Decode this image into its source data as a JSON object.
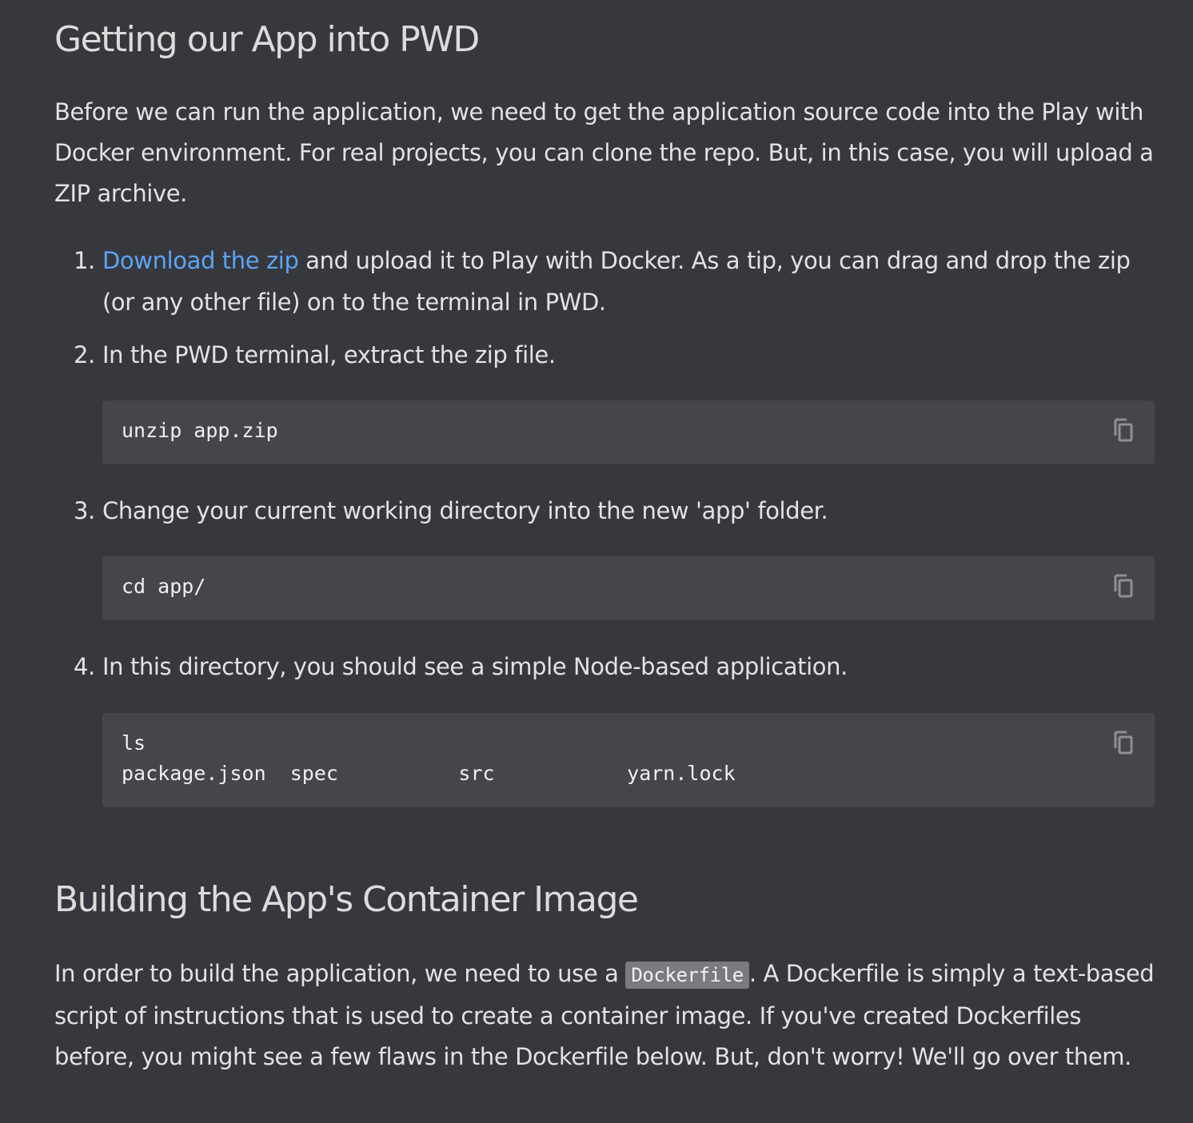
{
  "section1": {
    "heading": "Getting our App into PWD",
    "intro": "Before we can run the application, we need to get the application source code into the Play with Docker environment. For real projects, you can clone the repo. But, in this case, you will upload a ZIP archive."
  },
  "steps": [
    {
      "number": "1.",
      "link": "Download the zip",
      "text": " and upload it to Play with Docker. As a tip, you can drag and drop the zip (or any other file) on to the terminal in PWD."
    },
    {
      "number": "2.",
      "text": "In the PWD terminal, extract the zip file.",
      "code": "unzip app.zip"
    },
    {
      "number": "3.",
      "text": "Change your current working directory into the new 'app' folder.",
      "code": "cd app/"
    },
    {
      "number": "4.",
      "text": "In this directory, you should see a simple Node-based application.",
      "code": "ls\npackage.json  spec          src           yarn.lock"
    }
  ],
  "section2": {
    "heading": "Building the App's Container Image",
    "para_before": "In order to build the application, we need to use a ",
    "inline_code": "Dockerfile",
    "para_after": ". A Dockerfile is simply a text-based script of instructions that is used to create a container image. If you've created Dockerfiles before, you might see a few flaws in the Dockerfile below. But, don't worry! We'll go over them."
  },
  "icons": {
    "copy": "copy-icon"
  },
  "colors": {
    "background": "#37383d",
    "code_background": "#44464c",
    "link": "#5ba4f4"
  }
}
